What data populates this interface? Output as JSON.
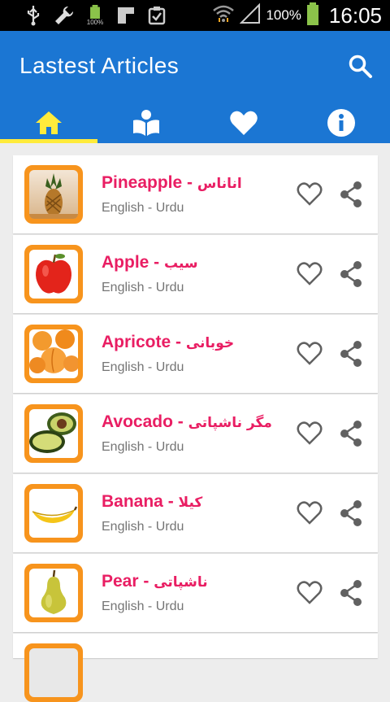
{
  "status_bar": {
    "battery_percent": "100%",
    "time": "16:05",
    "icons": [
      "usb-icon",
      "wrench-icon",
      "battery-small-icon",
      "image-icon",
      "clipboard-check-icon",
      "wifi-icon",
      "signal-icon",
      "battery-icon"
    ],
    "small_battery_label": "100%"
  },
  "app_bar": {
    "title": "Lastest Articles",
    "color": "#1b76d3",
    "search_icon": "search-icon"
  },
  "tabs": [
    {
      "icon": "home-icon",
      "active": true
    },
    {
      "icon": "reader-icon",
      "active": false
    },
    {
      "icon": "heart-icon",
      "active": false
    },
    {
      "icon": "info-icon",
      "active": false
    }
  ],
  "accent_colors": {
    "indicator": "#ffeb3b",
    "title": "#e91e63",
    "thumb_border": "#f7941d"
  },
  "articles": [
    {
      "english": "Pineapple - ",
      "urdu": "اناناس",
      "subtitle": "English - Urdu",
      "fruit_icon": "pineapple-icon"
    },
    {
      "english": "Apple - ",
      "urdu": "سیب",
      "subtitle": "English - Urdu",
      "fruit_icon": "apple-icon"
    },
    {
      "english": "Apricote - ",
      "urdu": "خوبانی",
      "subtitle": "English - Urdu",
      "fruit_icon": "apricot-icon"
    },
    {
      "english": "Avocado - ",
      "urdu": "مگر ناشپاتی",
      "subtitle": "English - Urdu",
      "fruit_icon": "avocado-icon"
    },
    {
      "english": "Banana - ",
      "urdu": "کیلا",
      "subtitle": "English - Urdu",
      "fruit_icon": "banana-icon"
    },
    {
      "english": "Pear - ",
      "urdu": "ناشپاتی",
      "subtitle": "English - Urdu",
      "fruit_icon": "pear-icon"
    }
  ]
}
